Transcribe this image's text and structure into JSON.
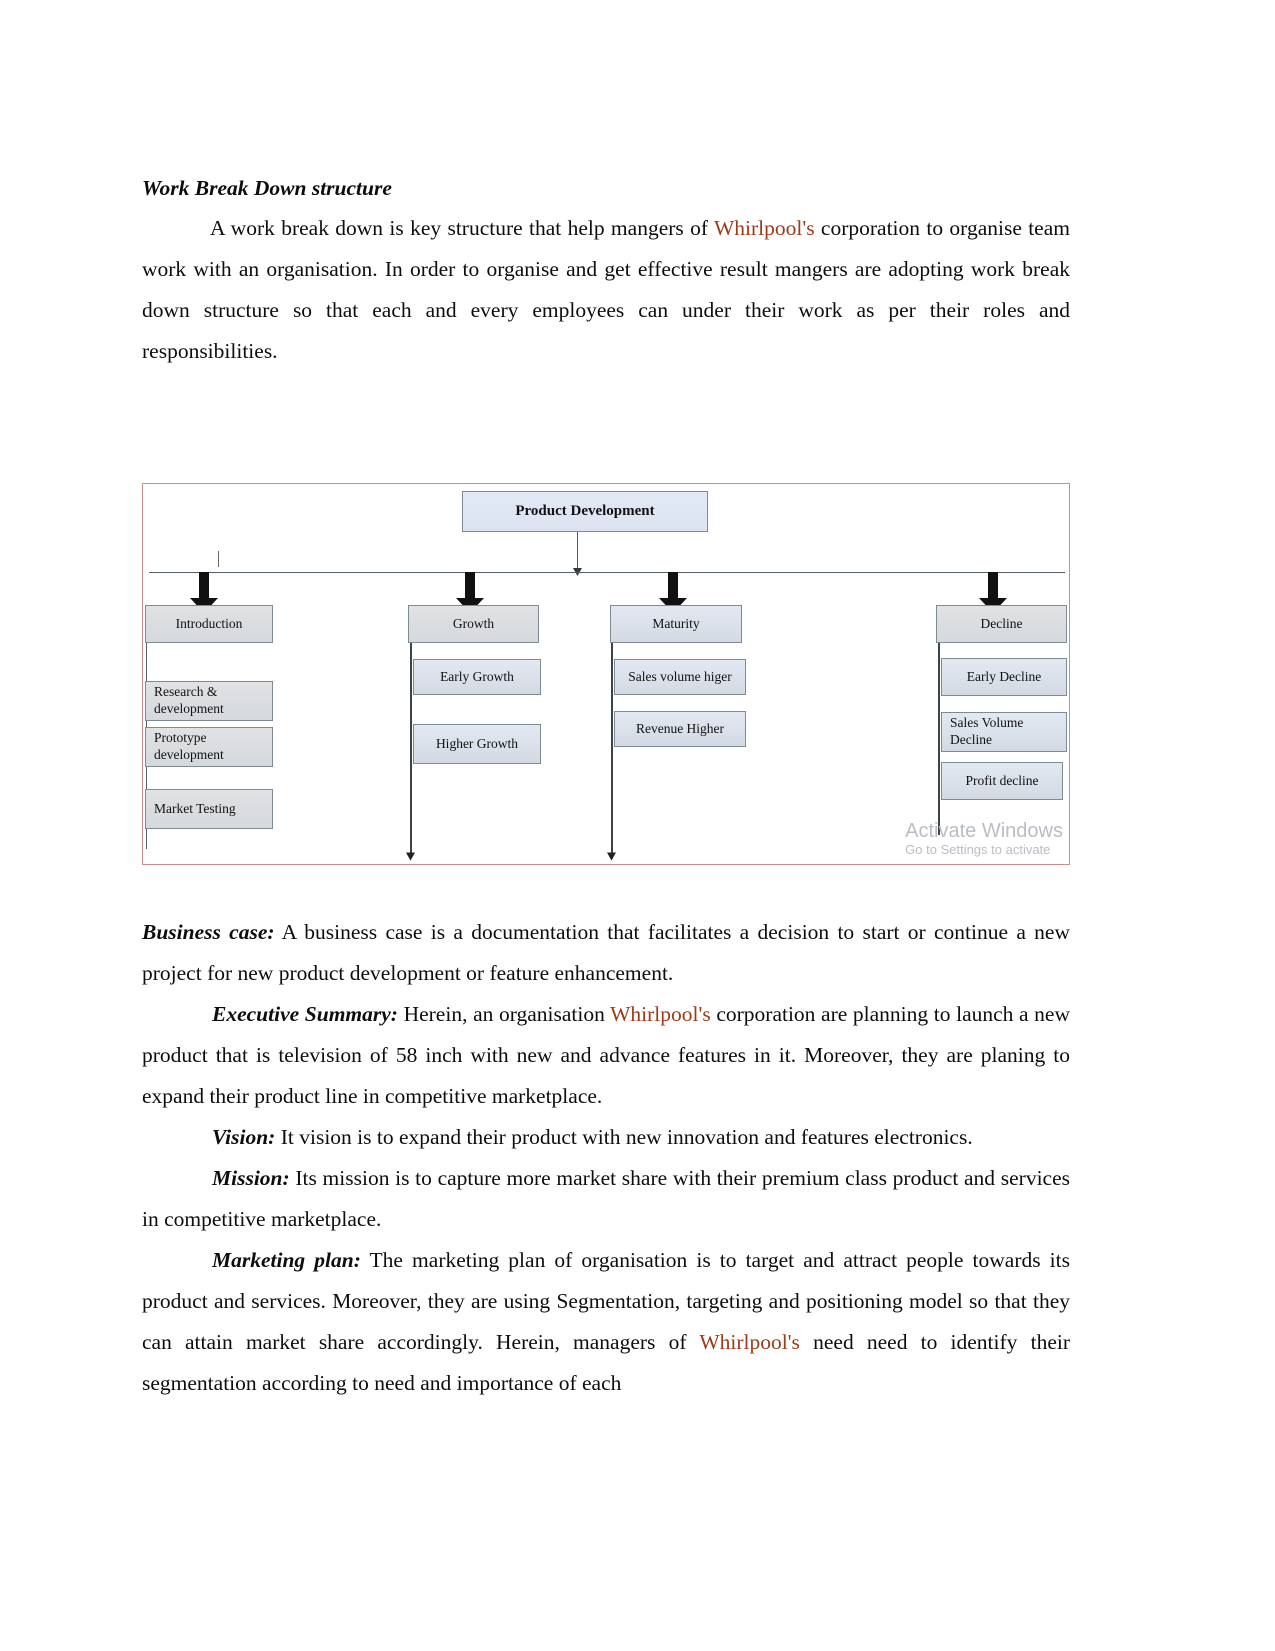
{
  "document": {
    "section_heading": "Work Break Down structure",
    "intro_paragraph": {
      "before_brand": "A work break down is key structure that help mangers of ",
      "brand": "Whirlpool's",
      "after_brand": " corporation to organise team work with an organisation. In order to organise and get effective result mangers are adopting work break down structure so that each and every employees can under their work as per their roles and responsibilities."
    },
    "business_case": {
      "label": "Business case:",
      "text": "  A business case is a documentation that facilitates a decision to start or continue a new project for new product development or feature enhancement."
    },
    "executive_summary": {
      "label": "Executive Summary:",
      "before_brand": "  Herein, an organisation ",
      "brand": "Whirlpool's",
      "after_brand": " corporation are planning to launch a new product that is television of 58 inch with new and advance features in it. Moreover, they are planing to expand their product line in competitive marketplace."
    },
    "vision": {
      "label": "Vision:",
      "text": "  It vision is to expand their product with new innovation and features electronics."
    },
    "mission": {
      "label": "Mission:",
      "text": "  Its mission is to capture more market share  with their premium class product and services in competitive marketplace."
    },
    "marketing_plan": {
      "label": "Marketing plan:",
      "before_brand": " The marketing plan of organisation is to target and attract people towards its product and services. Moreover, they are using Segmentation, targeting and positioning model so that they can attain market share accordingly. Herein, managers of ",
      "brand": "Whirlpool's",
      "after_brand": " need need to identify their  segmentation according to need and importance of each"
    }
  },
  "diagram": {
    "type": "tree",
    "root": "Product Development",
    "border_color": "#c98e8e",
    "node_fill": "#dde4ed",
    "branches": [
      {
        "label": "Introduction",
        "children": [
          "Research & development",
          "Prototype development",
          "Market Testing"
        ]
      },
      {
        "label": "Growth",
        "children": [
          "Early Growth",
          "Higher Growth"
        ]
      },
      {
        "label": "Maturity",
        "children": [
          "Sales volume higer",
          "Revenue Higher"
        ]
      },
      {
        "label": "Decline",
        "children": [
          "Early Decline",
          "Sales Volume Decline",
          "Profit decline"
        ]
      }
    ],
    "watermark": {
      "line1": "Activate Windows",
      "line2": "Go to Settings to activate"
    }
  }
}
